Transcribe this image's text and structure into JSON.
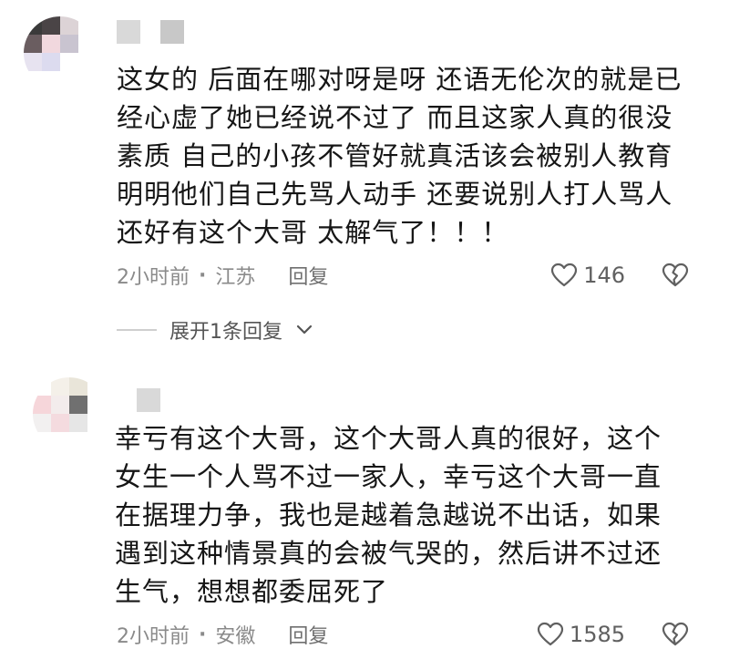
{
  "comments": [
    {
      "avatar_colors": [
        "#3a3a3a",
        "#4a4446",
        "#dcd3d6",
        "#ffffff",
        "#6a5d60",
        "#f1d8de",
        "#c9c4d0",
        "#ffffff",
        "#e7e3f0",
        "#dcdbef",
        "#ffffff",
        "#ffffff",
        "#ffffff",
        "#ffffff",
        "#ffffff",
        "#ffffff"
      ],
      "lines": [
        "这女的 后面在哪对呀是呀 还语无伦次的就是已",
        "经心虚了她已经说不过了 而且这家人真的很没",
        "素质 自己的小孩不管好就真活该会被别人教育",
        "明明他们自己先骂人动手 还要说别人打人骂人",
        "还好有这个大哥 太解气了！！！"
      ],
      "time": "2小时前",
      "location": "江苏",
      "reply_label": "回复",
      "likes": "146",
      "expand_label": "展开1条回复"
    },
    {
      "avatar_colors": [
        "#ffffff",
        "#f4f0e9",
        "#e9e5d9",
        "#ffffff",
        "#f6d6da",
        "#f3ecec",
        "#707070",
        "#ffffff",
        "#f2f0f0",
        "#f4dbdf",
        "#e6e6e6",
        "#ffffff",
        "#ffffff",
        "#ffffff",
        "#ffffff",
        "#ffffff"
      ],
      "lines": [
        "幸亏有这个大哥，这个大哥人真的很好，这个",
        "女生一个人骂不过一家人，幸亏这个大哥一直",
        "在据理力争，我也是越着急越说不出话，如果",
        "遇到这种情景真的会被气哭的，然后讲不过还",
        "生气，想想都委屈死了"
      ],
      "time": "2小时前",
      "location": "安徽",
      "reply_label": "回复",
      "likes": "1585"
    }
  ],
  "separator": "·",
  "icons": {
    "like": "heart-outline-icon",
    "dislike": "broken-heart-icon",
    "expand": "chevron-down-icon"
  },
  "colors": {
    "text": "#161616",
    "meta": "#8a8a8a",
    "icon": "#606060"
  }
}
